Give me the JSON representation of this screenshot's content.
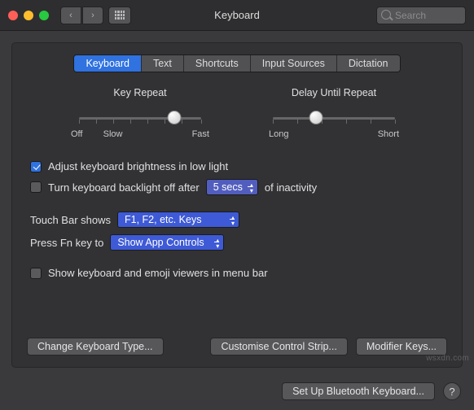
{
  "window": {
    "title": "Keyboard"
  },
  "search": {
    "placeholder": "Search"
  },
  "tabs": [
    {
      "label": "Keyboard",
      "active": true
    },
    {
      "label": "Text"
    },
    {
      "label": "Shortcuts"
    },
    {
      "label": "Input Sources"
    },
    {
      "label": "Dictation"
    }
  ],
  "sliders": {
    "key_repeat": {
      "title": "Key Repeat",
      "left": "Off",
      "left2": "Slow",
      "right": "Fast",
      "pos_pct": 78
    },
    "delay_repeat": {
      "title": "Delay Until Repeat",
      "left": "Long",
      "right": "Short",
      "pos_pct": 35
    }
  },
  "options": {
    "adjust_brightness": {
      "checked": true,
      "label": "Adjust keyboard brightness in low light"
    },
    "backlight_off": {
      "checked": false,
      "label_pre": "Turn keyboard backlight off after",
      "value": "5 secs",
      "label_post": "of inactivity"
    },
    "touch_bar": {
      "label": "Touch Bar shows",
      "value": "F1, F2, etc. Keys"
    },
    "press_fn": {
      "label": "Press Fn key to",
      "value": "Show App Controls"
    },
    "show_viewers": {
      "checked": false,
      "label": "Show keyboard and emoji viewers in menu bar"
    }
  },
  "buttons": {
    "change_type": "Change Keyboard Type...",
    "customise_strip": "Customise Control Strip...",
    "modifier_keys": "Modifier Keys...",
    "bluetooth": "Set Up Bluetooth Keyboard...",
    "help": "?"
  },
  "watermark": "wsxdn.com"
}
